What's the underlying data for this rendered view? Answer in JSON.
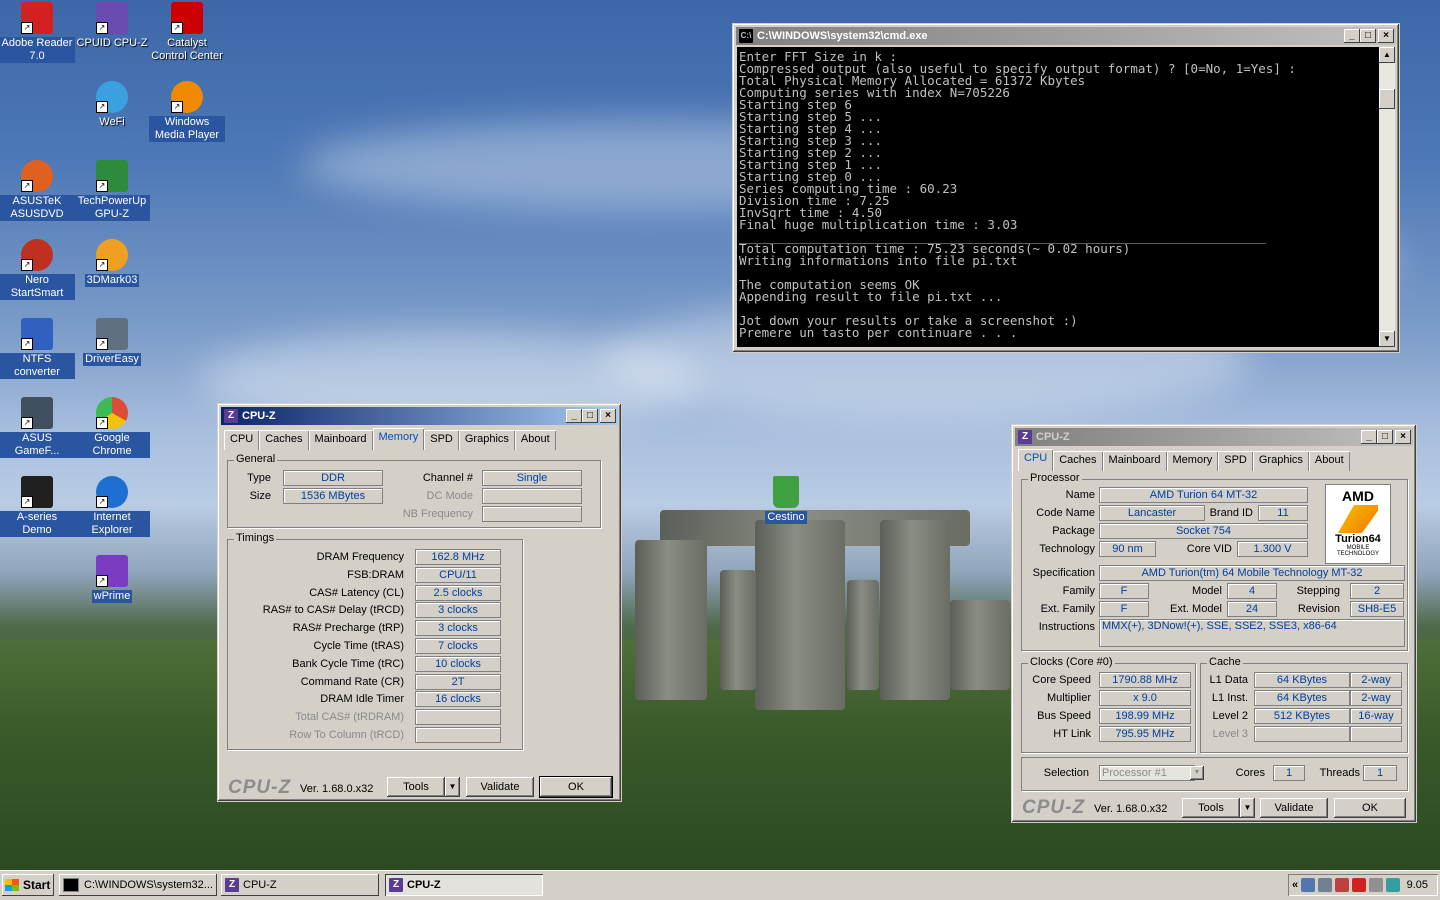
{
  "desktop": {
    "icons": [
      {
        "label": "Adobe Reader 7.0",
        "icon": "adobe-reader-icon",
        "color": "#d32020"
      },
      {
        "label": "CPUID CPU-Z",
        "icon": "cpuz-icon",
        "color": "#6a4cb0"
      },
      {
        "label": "Catalyst Control Center",
        "icon": "ati-icon",
        "color": "#cc0000"
      },
      {
        "label": "WeFi",
        "icon": "wefi-icon",
        "color": "#3aa0e0"
      },
      {
        "label": "Windows Media Player",
        "icon": "media-player-icon",
        "color": "#f08a00"
      },
      {
        "label": "ASUSTeK ASUSDVD",
        "icon": "asusdvd-icon",
        "color": "#e06020"
      },
      {
        "label": "TechPowerUp GPU-Z",
        "icon": "gpuz-icon",
        "color": "#2e8b3c"
      },
      {
        "label": "Nero StartSmart",
        "icon": "nero-icon",
        "color": "#c03020"
      },
      {
        "label": "3DMark03",
        "icon": "3dmark-icon",
        "color": "#f0a020"
      },
      {
        "label": "NTFS converter",
        "icon": "ntfs-icon",
        "color": "#3060c0"
      },
      {
        "label": "DriverEasy",
        "icon": "drivereasy-icon",
        "color": "#607080"
      },
      {
        "label": "ASUS GameF...",
        "icon": "asus-gamefirst-icon",
        "color": "#405060"
      },
      {
        "label": "Google Chrome",
        "icon": "chrome-icon",
        "color": "#dd4b39"
      },
      {
        "label": "A-series Demo",
        "icon": "a-series-icon",
        "color": "#202020"
      },
      {
        "label": "Internet Explorer",
        "icon": "ie-icon",
        "color": "#1e70d0"
      },
      {
        "label": "wPrime",
        "icon": "wprime-icon",
        "color": "#7a3cc0"
      },
      {
        "label": "Cestino",
        "icon": "recycle-bin-icon",
        "color": "#40a040"
      }
    ]
  },
  "cmd": {
    "title": "C:\\WINDOWS\\system32\\cmd.exe",
    "lines": [
      "Enter FFT Size in k :",
      "Compressed output (also useful to specify output format) ? [0=No, 1=Yes] :",
      "Total Physical Memory Allocated = 61372 Kbytes",
      "Computing series with index N=705226",
      "Starting step 6",
      "Starting step 5 ...",
      "Starting step 4 ...",
      "Starting step 3 ...",
      "Starting step 2 ...",
      "Starting step 1 ...",
      "Starting step 0 ...",
      "Series computing time : 60.23",
      "Division time : 7.25",
      "InvSqrt time : 4.50",
      "Final huge multiplication time : 3.03",
      "______________________________________________________________________",
      "Total computation time : 75.23 seconds(~ 0.02 hours)",
      "Writing informations into file pi.txt",
      "",
      "The computation seems OK",
      "Appending result to file pi.txt ...",
      "",
      "Jot down your results or take a screenshot :)",
      "Premere un tasto per continuare . . ."
    ]
  },
  "cpuz_mem": {
    "title": "CPU-Z",
    "tabs": [
      "CPU",
      "Caches",
      "Mainboard",
      "Memory",
      "SPD",
      "Graphics",
      "About"
    ],
    "selected_tab": "Memory",
    "general_title": "General",
    "type_label": "Type",
    "type_value": "DDR",
    "size_label": "Size",
    "size_value": "1536 MBytes",
    "channel_label": "Channel #",
    "channel_value": "Single",
    "dc_mode_label": "DC Mode",
    "nb_freq_label": "NB Frequency",
    "timings_title": "Timings",
    "timings": [
      {
        "label": "DRAM Frequency",
        "value": "162.8 MHz",
        "enabled": true
      },
      {
        "label": "FSB:DRAM",
        "value": "CPU/11",
        "enabled": true
      },
      {
        "label": "CAS# Latency (CL)",
        "value": "2.5 clocks",
        "enabled": true
      },
      {
        "label": "RAS# to CAS# Delay (tRCD)",
        "value": "3 clocks",
        "enabled": true
      },
      {
        "label": "RAS# Precharge (tRP)",
        "value": "3 clocks",
        "enabled": true
      },
      {
        "label": "Cycle Time (tRAS)",
        "value": "7 clocks",
        "enabled": true
      },
      {
        "label": "Bank Cycle Time (tRC)",
        "value": "10 clocks",
        "enabled": true
      },
      {
        "label": "Command Rate (CR)",
        "value": "2T",
        "enabled": true
      },
      {
        "label": "DRAM Idle Timer",
        "value": "16 clocks",
        "enabled": true
      },
      {
        "label": "Total CAS# (tRDRAM)",
        "value": "",
        "enabled": false
      },
      {
        "label": "Row To Column (tRCD)",
        "value": "",
        "enabled": false
      }
    ],
    "brand": "CPU-Z",
    "version": "Ver. 1.68.0.x32",
    "tools": "Tools",
    "validate": "Validate",
    "ok": "OK"
  },
  "cpuz_cpu": {
    "title": "CPU-Z",
    "tabs": [
      "CPU",
      "Caches",
      "Mainboard",
      "Memory",
      "SPD",
      "Graphics",
      "About"
    ],
    "selected_tab": "CPU",
    "processor_title": "Processor",
    "name_label": "Name",
    "name_value": "AMD Turion 64 MT-32",
    "codename_label": "Code Name",
    "codename_value": "Lancaster",
    "brandid_label": "Brand ID",
    "brandid_value": "11",
    "package_label": "Package",
    "package_value": "Socket 754",
    "technology_label": "Technology",
    "technology_value": "90 nm",
    "corevid_label": "Core VID",
    "corevid_value": "1.300 V",
    "spec_label": "Specification",
    "spec_value": "AMD Turion(tm) 64 Mobile Technology MT-32",
    "family_label": "Family",
    "family_value": "F",
    "model_label": "Model",
    "model_value": "4",
    "stepping_label": "Stepping",
    "stepping_value": "2",
    "extfamily_label": "Ext. Family",
    "extfamily_value": "F",
    "extmodel_label": "Ext. Model",
    "extmodel_value": "24",
    "revision_label": "Revision",
    "revision_value": "SH8-E5",
    "instructions_label": "Instructions",
    "instructions_value": "MMX(+), 3DNow!(+), SSE, SSE2, SSE3, x86-64",
    "logo_text": "AMD",
    "logo_product": "Turion64",
    "logo_sub": "MOBILE TECHNOLOGY",
    "clocks_title": "Clocks (Core #0)",
    "corespeed_label": "Core Speed",
    "corespeed_value": "1790.88 MHz",
    "multiplier_label": "Multiplier",
    "multiplier_value": "x 9.0",
    "busspeed_label": "Bus Speed",
    "busspeed_value": "198.99 MHz",
    "htlink_label": "HT Link",
    "htlink_value": "795.95 MHz",
    "cache_title": "Cache",
    "l1d_label": "L1 Data",
    "l1d_value": "64 KBytes",
    "l1d_way": "2-way",
    "l1i_label": "L1 Inst.",
    "l1i_value": "64 KBytes",
    "l1i_way": "2-way",
    "l2_label": "Level 2",
    "l2_value": "512 KBytes",
    "l2_way": "16-way",
    "l3_label": "Level 3",
    "selection_label": "Selection",
    "selection_value": "Processor #1",
    "cores_label": "Cores",
    "cores_value": "1",
    "threads_label": "Threads",
    "threads_value": "1",
    "brand": "CPU-Z",
    "version": "Ver. 1.68.0.x32",
    "tools": "Tools",
    "validate": "Validate",
    "ok": "OK"
  },
  "taskbar": {
    "start_label": "Start",
    "items": [
      {
        "label": "C:\\WINDOWS\\system32...",
        "pressed": false
      },
      {
        "label": "CPU-Z",
        "pressed": false
      },
      {
        "label": "CPU-Z",
        "pressed": true
      }
    ],
    "expand_label": "«",
    "clock": "9.05"
  }
}
